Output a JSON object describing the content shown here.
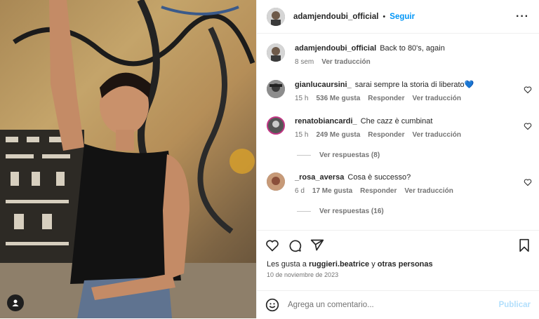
{
  "post": {
    "username": "adamjendoubi_official",
    "follow_label": "Seguir",
    "caption": "Back to 80's, again",
    "caption_time": "8 sem",
    "see_translation": "Ver traducción"
  },
  "comments": [
    {
      "user": "gianlucaursini_",
      "text": "sarai sempre la storia di liberato💙",
      "time": "15 h",
      "likes": "536 Me gusta",
      "reply": "Responder",
      "translate": "Ver traducción"
    },
    {
      "user": "renatobiancardi_",
      "text": "Che cazz è cumbinat",
      "time": "15 h",
      "likes": "249 Me gusta",
      "reply": "Responder",
      "translate": "Ver traducción",
      "view_replies": "Ver respuestas (8)"
    },
    {
      "user": "_rosa_aversa",
      "text": "Cosa è successo?",
      "time": "6 d",
      "likes": "17 Me gusta",
      "reply": "Responder",
      "translate": "Ver traducción",
      "view_replies": "Ver respuestas (16)"
    }
  ],
  "likes": {
    "prefix": "Les gusta a",
    "user": "ruggieri.beatrice",
    "and": "y",
    "others": "otras personas"
  },
  "date": "10 de noviembre de 2023",
  "comment_box": {
    "placeholder": "Agrega un comentario...",
    "publish": "Publicar"
  },
  "colors": {
    "accent": "#0095f6",
    "publish_disabled": "#b2dffc"
  },
  "icons": [
    "tag-user-icon",
    "more-icon",
    "heart-icon",
    "comment-icon",
    "share-icon",
    "bookmark-icon",
    "emoji-icon"
  ]
}
